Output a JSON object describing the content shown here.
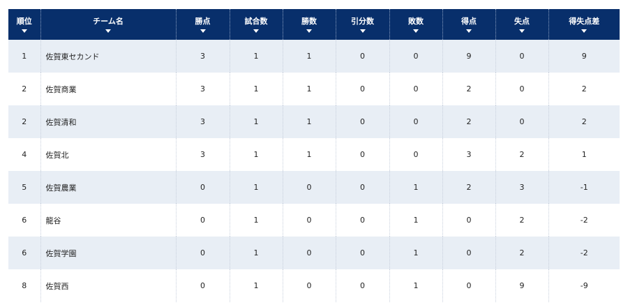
{
  "table": {
    "columns": [
      {
        "key": "rank",
        "label": "順位",
        "name": "col-rank"
      },
      {
        "key": "team",
        "label": "チーム名",
        "name": "col-team"
      },
      {
        "key": "points",
        "label": "勝点",
        "name": "col-points"
      },
      {
        "key": "games",
        "label": "試合数",
        "name": "col-games"
      },
      {
        "key": "wins",
        "label": "勝数",
        "name": "col-wins"
      },
      {
        "key": "draws",
        "label": "引分数",
        "name": "col-draws"
      },
      {
        "key": "losses",
        "label": "敗数",
        "name": "col-losses"
      },
      {
        "key": "goals_for",
        "label": "得点",
        "name": "col-goals-for"
      },
      {
        "key": "goals_against",
        "label": "失点",
        "name": "col-goals-against"
      },
      {
        "key": "goal_diff",
        "label": "得失点差",
        "name": "col-goal-diff"
      }
    ],
    "rows": [
      {
        "rank": "1",
        "team": "佐賀東セカンド",
        "points": "3",
        "games": "1",
        "wins": "1",
        "draws": "0",
        "losses": "0",
        "goals_for": "9",
        "goals_against": "0",
        "goal_diff": "9"
      },
      {
        "rank": "2",
        "team": "佐賀商業",
        "points": "3",
        "games": "1",
        "wins": "1",
        "draws": "0",
        "losses": "0",
        "goals_for": "2",
        "goals_against": "0",
        "goal_diff": "2"
      },
      {
        "rank": "2",
        "team": "佐賀清和",
        "points": "3",
        "games": "1",
        "wins": "1",
        "draws": "0",
        "losses": "0",
        "goals_for": "2",
        "goals_against": "0",
        "goal_diff": "2"
      },
      {
        "rank": "4",
        "team": "佐賀北",
        "points": "3",
        "games": "1",
        "wins": "1",
        "draws": "0",
        "losses": "0",
        "goals_for": "3",
        "goals_against": "2",
        "goal_diff": "1"
      },
      {
        "rank": "5",
        "team": "佐賀農業",
        "points": "0",
        "games": "1",
        "wins": "0",
        "draws": "0",
        "losses": "1",
        "goals_for": "2",
        "goals_against": "3",
        "goal_diff": "-1"
      },
      {
        "rank": "6",
        "team": "龍谷",
        "points": "0",
        "games": "1",
        "wins": "0",
        "draws": "0",
        "losses": "1",
        "goals_for": "0",
        "goals_against": "2",
        "goal_diff": "-2"
      },
      {
        "rank": "6",
        "team": "佐賀学園",
        "points": "0",
        "games": "1",
        "wins": "0",
        "draws": "0",
        "losses": "1",
        "goals_for": "0",
        "goals_against": "2",
        "goal_diff": "-2"
      },
      {
        "rank": "8",
        "team": "佐賀西",
        "points": "0",
        "games": "1",
        "wins": "0",
        "draws": "0",
        "losses": "1",
        "goals_for": "0",
        "goals_against": "9",
        "goal_diff": "-9"
      }
    ]
  },
  "colors": {
    "header_bg": "#082f6b",
    "header_text": "#ffffff",
    "row_alt_bg": "#e8eef5",
    "row_bg": "#ffffff"
  },
  "icons": {
    "sort": "sort-down-icon"
  }
}
